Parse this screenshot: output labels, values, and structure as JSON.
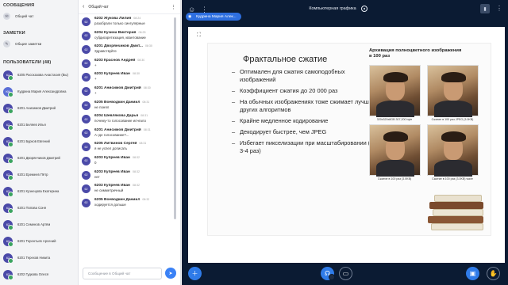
{
  "sidebar": {
    "messages_title": "СООБЩЕНИЯ",
    "public_chat_label": "Общий чат",
    "notes_title": "ЗАМЕТКИ",
    "shared_notes_label": "Общие заметки",
    "users_title": "ПОЛЬЗОВАТЕЛИ (48)",
    "users": [
      {
        "initials": "62",
        "name": "6205 Рассказова Анастасия (Вы)"
      },
      {
        "initials": "КМ",
        "name": "Кудрина Мария Александровна"
      },
      {
        "initials": "62",
        "name": "6201 Анисимов Дмитрий"
      },
      {
        "initials": "62",
        "name": "6201 Беляев Илья"
      },
      {
        "initials": "62",
        "name": "6201 Бурков Евгений"
      },
      {
        "initials": "62",
        "name": "6201 Дворянчиков Дмитрий"
      },
      {
        "initials": "62",
        "name": "6201 Еремеев Пётр"
      },
      {
        "initials": "62",
        "name": "6201 Кузнецова Екатерина"
      },
      {
        "initials": "62",
        "name": "6201 Попова Соня"
      },
      {
        "initials": "62",
        "name": "6201 Семенов Артём"
      },
      {
        "initials": "62",
        "name": "6201 Терентьев Арсений"
      },
      {
        "initials": "62",
        "name": "6201 Терехов Никита"
      },
      {
        "initials": "62",
        "name": "6202 Гудкова Олеся"
      }
    ]
  },
  "chat": {
    "title": "Общий чат",
    "placeholder": "Сообщение в Общий чат",
    "messages": [
      {
        "initials": "62",
        "who": "6202 Жукова Лилия",
        "time": "08:24",
        "text": "разобрали только сингулярные"
      },
      {
        "initials": "62",
        "who": "6204 Кузина Виктория",
        "time": "08:25",
        "text": "субдискретизация, квантование"
      },
      {
        "initials": "62",
        "who": "6201 Дворянчиков Дмит...",
        "time": "08:30",
        "text": "Здравствуйте"
      },
      {
        "initials": "62",
        "who": "6203 Краснов Андрей",
        "time": "08:30",
        "text": "+"
      },
      {
        "initials": "62",
        "who": "6203 Купреев Иван",
        "time": "08:30",
        "text": "+"
      },
      {
        "initials": "62",
        "who": "6201 Анисимов Дмитрий",
        "time": "08:30",
        "text": "+"
      },
      {
        "initials": "62",
        "who": "6205 Воеводкин Даниил",
        "time": "08:31",
        "text": "не понял"
      },
      {
        "initials": "62",
        "who": "6204 Шевлякова Дарья",
        "time": "08:31",
        "text": "почему-то голосование исчезло"
      },
      {
        "initials": "62",
        "who": "6201 Анисимов Дмитрий",
        "time": "08:31",
        "text": "А где голосование?..."
      },
      {
        "initials": "62",
        "who": "6205 Литвинов Сергей",
        "time": "08:31",
        "text": "я не успел дописать"
      },
      {
        "initials": "62",
        "who": "6203 Купреев Иван",
        "time": "08:32",
        "text": "0"
      },
      {
        "initials": "62",
        "who": "6203 Купреев Иван",
        "time": "08:32",
        "text": "нет"
      },
      {
        "initials": "62",
        "who": "6203 Купреев Иван",
        "time": "08:32",
        "text": "не симметричный"
      },
      {
        "initials": "62",
        "who": "6205 Воеводкин Даниил",
        "time": "08:32",
        "text": "ходируется дольше"
      }
    ]
  },
  "stage": {
    "title": "Компьютерная графика",
    "presenter": "Кудрина Мария Алек...",
    "slide": {
      "title": "Фрактальное сжатие",
      "bullets": [
        "Оптимален для сжатия самоподобных изображений",
        "Коэффициент сжатия до 20 000 раз",
        "На обычных изображениях тоже сжимает лучше других алгоритмов",
        "Крайне медленное кодирование",
        "Декодирует быстрее, чем JPEG",
        "Избегает пикселизации при масштабировании (до 3-4 раз)"
      ],
      "archive_title_line1": "Архивация полноцветного изображения",
      "archive_title_line2": "в 100 раз",
      "captions": [
        "320x320x8GB   307,200 byte",
        "Сжатие в 100 раз JPEG (3.0KB)",
        "Сжатие в 100 раз (3.0KB)",
        "Сжатие в 100 раз (3.0KB) wave"
      ]
    }
  },
  "colors": {
    "accent": "#2f7be8",
    "avatar": "#4b4aa8",
    "stage_bg": "#0b1b33",
    "online": "#3aa45f"
  }
}
